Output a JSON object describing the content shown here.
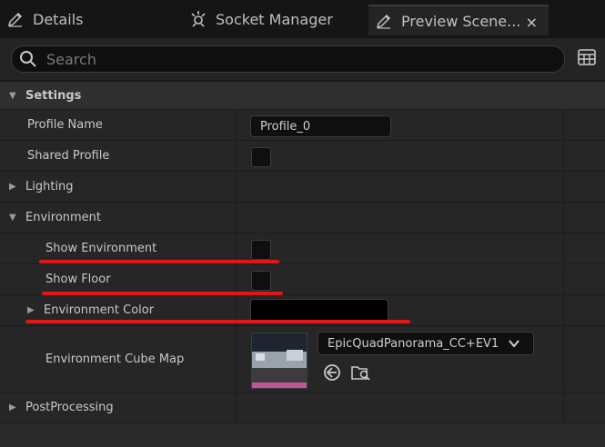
{
  "tabs": [
    {
      "label": "Details",
      "icon": "pencil-icon"
    },
    {
      "label": "Socket Manager",
      "icon": "socket-icon"
    },
    {
      "label": "Preview Scene...",
      "icon": "pencil-icon",
      "active": true
    }
  ],
  "tab_close": "×",
  "search": {
    "placeholder": "Search"
  },
  "rows": {
    "settings": "Settings",
    "profile_name": "Profile Name",
    "profile_value": "Profile_0",
    "shared_profile": "Shared Profile",
    "lighting": "Lighting",
    "environment": "Environment",
    "show_environment": "Show Environment",
    "show_floor": "Show Floor",
    "environment_color": "Environment Color",
    "environment_cube_map": "Environment Cube Map",
    "cube_map_value": "EpicQuadPanorama_CC+EV1",
    "post_processing": "PostProcessing"
  },
  "colors": {
    "annotation_red": "#e0161b",
    "environment_color_value": "#000000"
  }
}
